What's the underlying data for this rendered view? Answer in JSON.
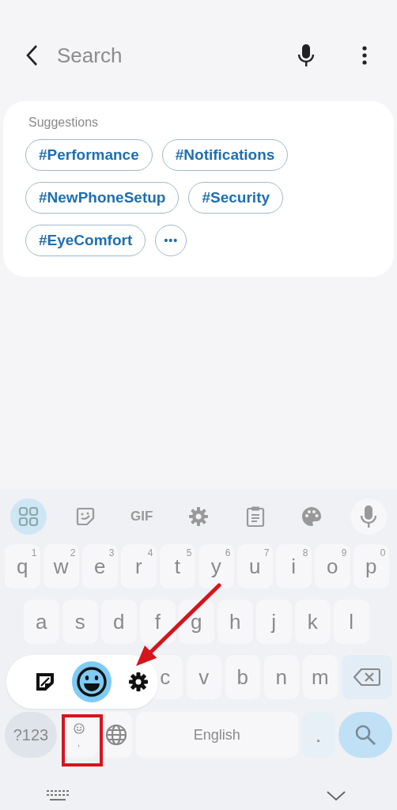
{
  "header": {
    "placeholder": "Search"
  },
  "suggestions": {
    "title": "Suggestions",
    "tags": [
      {
        "label": "#Performance"
      },
      {
        "label": "#Notifications"
      },
      {
        "label": "#NewPhoneSetup"
      },
      {
        "label": "#Security"
      },
      {
        "label": "#EyeComfort"
      }
    ],
    "more": "•••"
  },
  "keyboard": {
    "toolbar": [
      {
        "kind": "grid",
        "selected": true
      },
      {
        "kind": "sticker",
        "selected": false
      },
      {
        "kind": "gif",
        "label": "GIF",
        "selected": false
      },
      {
        "kind": "settings",
        "selected": false
      },
      {
        "kind": "clipboard",
        "selected": false
      },
      {
        "kind": "palette",
        "selected": false
      },
      {
        "kind": "mic",
        "selected": false
      }
    ],
    "row1": [
      {
        "key": "q",
        "hint": "1"
      },
      {
        "key": "w",
        "hint": "2"
      },
      {
        "key": "e",
        "hint": "3"
      },
      {
        "key": "r",
        "hint": "4"
      },
      {
        "key": "t",
        "hint": "5"
      },
      {
        "key": "y",
        "hint": "6"
      },
      {
        "key": "u",
        "hint": "7"
      },
      {
        "key": "i",
        "hint": "8"
      },
      {
        "key": "o",
        "hint": "9"
      },
      {
        "key": "p",
        "hint": "0"
      }
    ],
    "row2": [
      "a",
      "s",
      "d",
      "f",
      "g",
      "h",
      "j",
      "k",
      "l"
    ],
    "row3": [
      "c",
      "v",
      "b",
      "n",
      "m"
    ],
    "symbols_key": "?123",
    "emoji_key_hint": ",",
    "space": "English",
    "period": ".",
    "popup": [
      {
        "kind": "sticker",
        "selected": false
      },
      {
        "kind": "emoji",
        "selected": true
      },
      {
        "kind": "settings",
        "selected": false
      }
    ]
  },
  "annotations": {
    "arrow": true,
    "highlight_box": true
  }
}
